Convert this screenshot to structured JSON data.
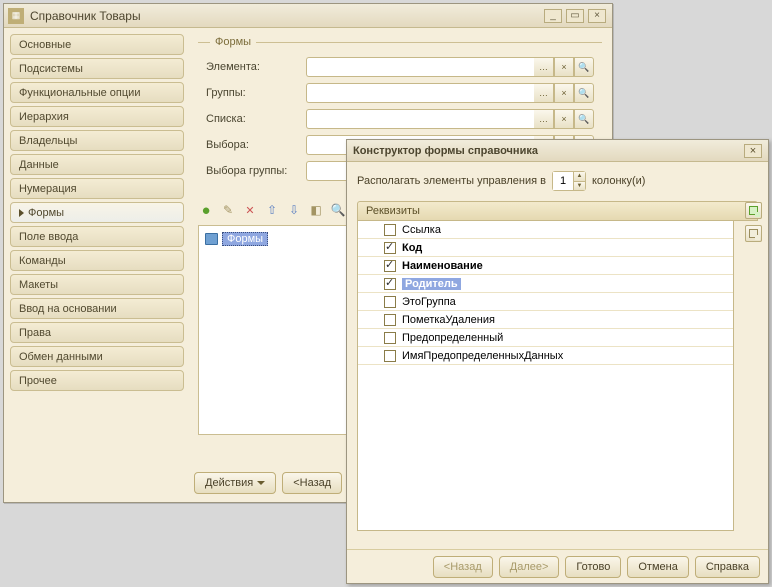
{
  "main": {
    "title": "Справочник Товары",
    "sidebar": {
      "items": [
        {
          "label": "Основные",
          "active": false
        },
        {
          "label": "Подсистемы",
          "active": false
        },
        {
          "label": "Функциональные опции",
          "active": false
        },
        {
          "label": "Иерархия",
          "active": false
        },
        {
          "label": "Владельцы",
          "active": false
        },
        {
          "label": "Данные",
          "active": false
        },
        {
          "label": "Нумерация",
          "active": false
        },
        {
          "label": "Формы",
          "active": true
        },
        {
          "label": "Поле ввода",
          "active": false
        },
        {
          "label": "Команды",
          "active": false
        },
        {
          "label": "Макеты",
          "active": false
        },
        {
          "label": "Ввод на основании",
          "active": false
        },
        {
          "label": "Права",
          "active": false
        },
        {
          "label": "Обмен данными",
          "active": false
        },
        {
          "label": "Прочее",
          "active": false
        }
      ]
    },
    "group": {
      "title": "Формы",
      "rows": [
        {
          "label": "Элемента:",
          "value": ""
        },
        {
          "label": "Группы:",
          "value": ""
        },
        {
          "label": "Списка:",
          "value": ""
        },
        {
          "label": "Выбора:",
          "value": ""
        },
        {
          "label": "Выбора группы:",
          "value": ""
        }
      ],
      "ellipsis": "…"
    },
    "tree": {
      "root": "Формы"
    },
    "footer": {
      "actions": "Действия",
      "back": "<Назад"
    }
  },
  "dialog": {
    "title": "Конструктор формы справочника",
    "colRow": {
      "prefix": "Располагать элементы управления в",
      "value": "1",
      "suffix": "колонку(и)"
    },
    "reqHeader": "Реквизиты",
    "items": [
      {
        "label": "Ссылка",
        "checked": false,
        "selected": false
      },
      {
        "label": "Код",
        "checked": true,
        "selected": false
      },
      {
        "label": "Наименование",
        "checked": true,
        "selected": false
      },
      {
        "label": "Родитель",
        "checked": true,
        "selected": true
      },
      {
        "label": "ЭтоГруппа",
        "checked": false,
        "selected": false
      },
      {
        "label": "ПометкаУдаления",
        "checked": false,
        "selected": false
      },
      {
        "label": "Предопределенный",
        "checked": false,
        "selected": false
      },
      {
        "label": "ИмяПредопределенныхДанных",
        "checked": false,
        "selected": false
      }
    ],
    "buttons": {
      "back": "<Назад",
      "next": "Далее>",
      "ok": "Готово",
      "cancel": "Отмена",
      "help": "Справка"
    }
  },
  "icons": {
    "close": "×",
    "min": "_",
    "rest": "▭",
    "mag": "🔍",
    "dots": "…",
    "clear": "×"
  }
}
